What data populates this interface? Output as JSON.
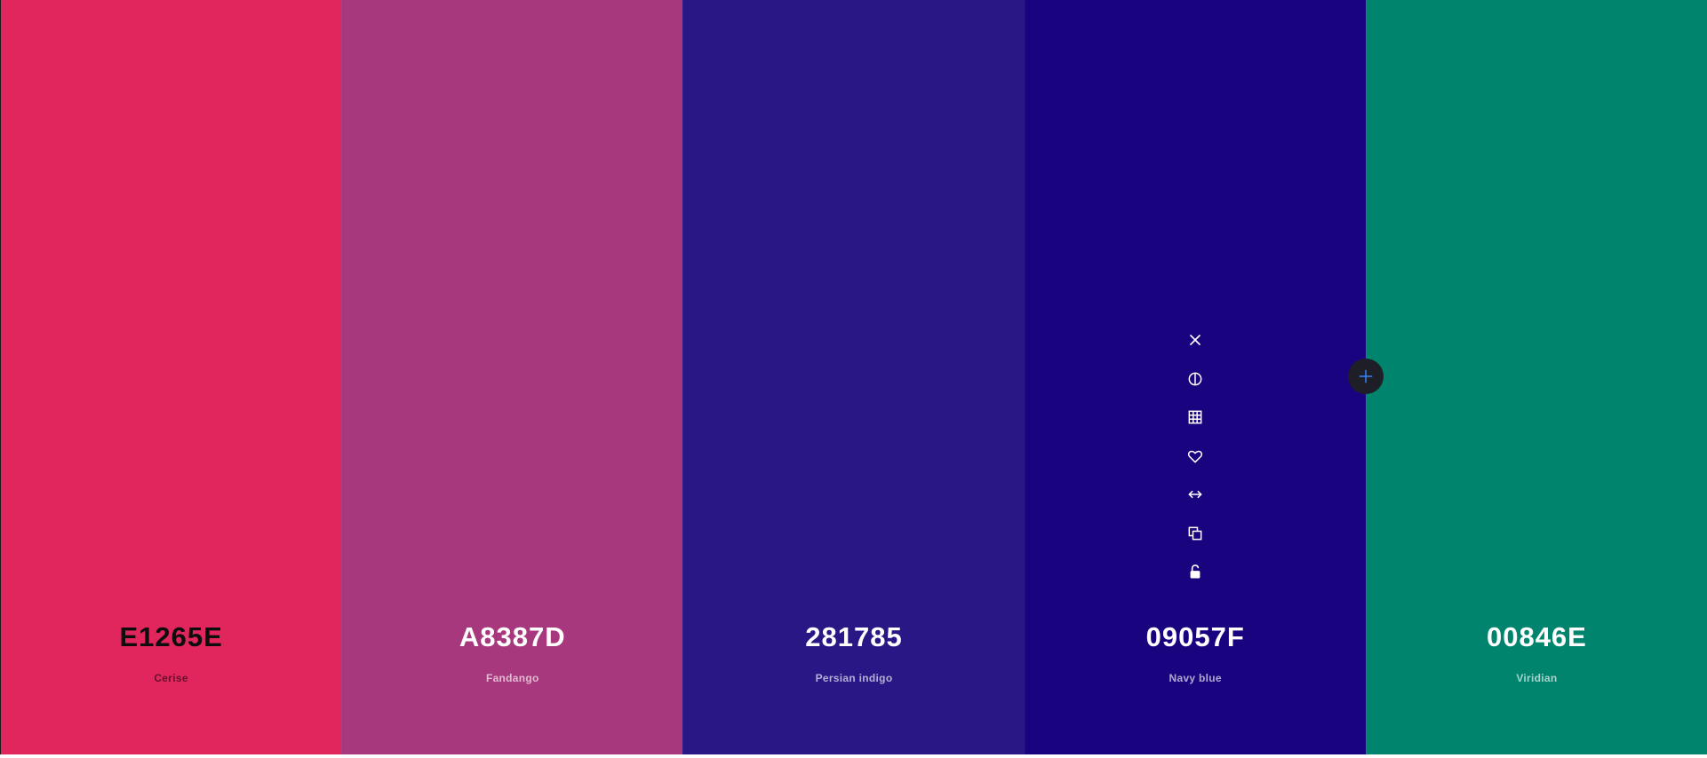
{
  "palette": {
    "colors": [
      {
        "hex": "E1265E",
        "name": "Cerise",
        "bg": "#E1265E",
        "text_theme": "dark"
      },
      {
        "hex": "A8387D",
        "name": "Fandango",
        "bg": "#A8387D",
        "text_theme": "light"
      },
      {
        "hex": "281785",
        "name": "Persian indigo",
        "bg": "#281785",
        "text_theme": "light"
      },
      {
        "hex": "09057F",
        "name": "Navy blue",
        "bg": "#1A037F",
        "text_theme": "light"
      },
      {
        "hex": "00846E",
        "name": "Viridian",
        "bg": "#00846E",
        "text_theme": "light"
      }
    ]
  },
  "toolbar": {
    "icons": [
      "close-icon",
      "contrast-icon",
      "shades-grid-icon",
      "heart-icon",
      "drag-arrows-icon",
      "copy-icon",
      "unlock-icon"
    ]
  },
  "add_button": {
    "icon": "plus-icon",
    "icon_color": "#3b82f6",
    "bg_color": "#1e1f26"
  }
}
